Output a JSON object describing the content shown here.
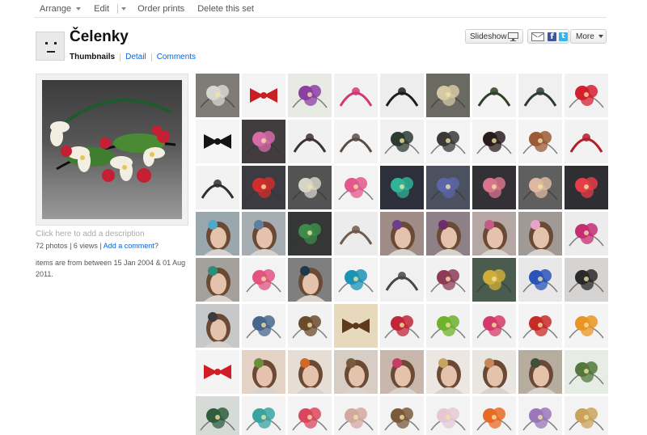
{
  "toolbar": {
    "arrange": "Arrange",
    "edit": "Edit",
    "order_prints": "Order prints",
    "delete_set": "Delete this set"
  },
  "set": {
    "title": "Čelenky",
    "tabs": {
      "thumbnails": "Thumbnails",
      "detail": "Detail",
      "comments": "Comments"
    },
    "add_description": "Click here to add a description",
    "photos": "72 photos",
    "views": "6 views",
    "add_comment": "Add a comment",
    "question": "?",
    "dates": "items are from between 15 Jan 2004 & 01 Aug 2011."
  },
  "buttons": {
    "slideshow": "Slideshow",
    "more": "More",
    "facebook": "f",
    "twitter": "t"
  },
  "thumbnails": [
    {
      "bg": "#7f7c77",
      "fg": "#d7d7d2",
      "shape": "flower",
      "subject": "fabric flower"
    },
    {
      "bg": "#f3f3f3",
      "fg": "#c81f25",
      "shape": "bow",
      "subject": "red rosette"
    },
    {
      "bg": "#e8ebe3",
      "fg": "#8b3fa2",
      "shape": "flower",
      "subject": "fabric flowers"
    },
    {
      "bg": "#f2f2f2",
      "fg": "#d23873",
      "shape": "band",
      "subject": "pink headband"
    },
    {
      "bg": "#ededed",
      "fg": "#1d1d1d",
      "shape": "band",
      "subject": "black headband"
    },
    {
      "bg": "#6b6a62",
      "fg": "#d5c8a5",
      "shape": "flower",
      "subject": "braided band"
    },
    {
      "bg": "#f4f4f4",
      "fg": "#2f4126",
      "shape": "band",
      "subject": "green headband"
    },
    {
      "bg": "#f0f0f0",
      "fg": "#2b3b33",
      "shape": "band",
      "subject": "dark headband"
    },
    {
      "bg": "#f2f2f2",
      "fg": "#d41f2f",
      "shape": "flower",
      "subject": "red flowers"
    },
    {
      "bg": "#f5f5f5",
      "fg": "#141414",
      "shape": "bow",
      "subject": "black bow"
    },
    {
      "bg": "#413d3f",
      "fg": "#d86aa9",
      "shape": "flower",
      "subject": "pink flower"
    },
    {
      "bg": "#f1f1f1",
      "fg": "#3c3032",
      "shape": "band",
      "subject": "beaded band"
    },
    {
      "bg": "#f4f4f4",
      "fg": "#5b4d46",
      "shape": "band",
      "subject": "jeweled band"
    },
    {
      "bg": "#f1f1f1",
      "fg": "#2d3b32",
      "shape": "flower",
      "subject": "crystal band"
    },
    {
      "bg": "#f3f3f3",
      "fg": "#3a3a3a",
      "shape": "flower",
      "subject": "brooch band"
    },
    {
      "bg": "#f3f3f3",
      "fg": "#2a1c1c",
      "shape": "flower",
      "subject": "black flower"
    },
    {
      "bg": "#f4f4f4",
      "fg": "#9b5a36",
      "shape": "flower",
      "subject": "beaded flower"
    },
    {
      "bg": "#f2f2f2",
      "fg": "#b21d2a",
      "shape": "band",
      "subject": "red beaded"
    },
    {
      "bg": "#f2f2f2",
      "fg": "#2f2f2f",
      "shape": "band",
      "subject": "crystal band"
    },
    {
      "bg": "#3c3b41",
      "fg": "#d12d2d",
      "shape": "flower",
      "subject": "red flower"
    },
    {
      "bg": "#535353",
      "fg": "#d6d3c7",
      "shape": "flower",
      "subject": "lace"
    },
    {
      "bg": "#f3f3f3",
      "fg": "#e3578c",
      "shape": "flower",
      "subject": "pink feathers"
    },
    {
      "bg": "#2d2f3a",
      "fg": "#2eb397",
      "shape": "flower",
      "subject": "teal roses"
    },
    {
      "bg": "#4c5160",
      "fg": "#5a66a8",
      "shape": "flower",
      "subject": "blue flowers"
    },
    {
      "bg": "#333135",
      "fg": "#d8748c",
      "shape": "flower",
      "subject": "pink lace"
    },
    {
      "bg": "#5f5f5f",
      "fg": "#ddb8a0",
      "shape": "flower",
      "subject": "cream roses"
    },
    {
      "bg": "#2e2e33",
      "fg": "#e53d49",
      "shape": "flower",
      "subject": "red roses"
    },
    {
      "bg": "#9aa7ad",
      "fg": "#52a7c7",
      "shape": "portrait",
      "subject": "portrait"
    },
    {
      "bg": "#a6aeb3",
      "fg": "#5f7fa0",
      "shape": "portrait",
      "subject": "portrait"
    },
    {
      "bg": "#353737",
      "fg": "#3d8b4b",
      "shape": "flower",
      "subject": "green bow"
    },
    {
      "bg": "#ececec",
      "fg": "#6d5b4f",
      "shape": "band",
      "subject": "brown band"
    },
    {
      "bg": "#9f8c86",
      "fg": "#6c3d8c",
      "shape": "portrait",
      "subject": "portrait"
    },
    {
      "bg": "#8d8086",
      "fg": "#6f2c6c",
      "shape": "portrait",
      "subject": "portrait"
    },
    {
      "bg": "#b4a7a4",
      "fg": "#c75a86",
      "shape": "portrait",
      "subject": "portrait"
    },
    {
      "bg": "#9f9a95",
      "fg": "#e8a4c8",
      "shape": "portrait",
      "subject": "portrait"
    },
    {
      "bg": "#ececec",
      "fg": "#c62e74",
      "shape": "flower",
      "subject": "magenta flower"
    },
    {
      "bg": "#a4a09c",
      "fg": "#2c8d7c",
      "shape": "portrait",
      "subject": "portrait"
    },
    {
      "bg": "#f3f3f3",
      "fg": "#e0547f",
      "shape": "flower",
      "subject": "pink feather"
    },
    {
      "bg": "#7f7f7f",
      "fg": "#1f3848",
      "shape": "portrait",
      "subject": "portrait"
    },
    {
      "bg": "#f3f3f3",
      "fg": "#1c93b5",
      "shape": "flower",
      "subject": "blue feathers"
    },
    {
      "bg": "#f0f0f0",
      "fg": "#474747",
      "shape": "band",
      "subject": "plain band"
    },
    {
      "bg": "#f1f1f1",
      "fg": "#8e3c56",
      "shape": "flower",
      "subject": "mixed flower"
    },
    {
      "bg": "#4a5c4d",
      "fg": "#cfad3a",
      "shape": "flower",
      "subject": "gold flower"
    },
    {
      "bg": "#e8e8e8",
      "fg": "#2954b8",
      "shape": "flower",
      "subject": "blue beads"
    },
    {
      "bg": "#d6d4d2",
      "fg": "#2a2a2a",
      "shape": "flower",
      "subject": "black band"
    },
    {
      "bg": "#c6c8c9",
      "fg": "#3c3c3c",
      "shape": "portrait",
      "subject": "portrait"
    },
    {
      "bg": "#f3f3f3",
      "fg": "#46668c",
      "shape": "flower",
      "subject": "blue flower"
    },
    {
      "bg": "#f2f2f2",
      "fg": "#6b4b2e",
      "shape": "flower",
      "subject": "brown flower"
    },
    {
      "bg": "#e6d9bc",
      "fg": "#5e3a1c",
      "shape": "bow",
      "subject": "brown feathers"
    },
    {
      "bg": "#f2f2f2",
      "fg": "#c02638",
      "shape": "flower",
      "subject": "red flowers"
    },
    {
      "bg": "#f2f2f2",
      "fg": "#6fb22e",
      "shape": "flower",
      "subject": "green leaf"
    },
    {
      "bg": "#f2f2f2",
      "fg": "#d4396a",
      "shape": "flower",
      "subject": "fan"
    },
    {
      "bg": "#f4f4f4",
      "fg": "#c72b27",
      "shape": "flower",
      "subject": "red flowers"
    },
    {
      "bg": "#f4f4f4",
      "fg": "#e99523",
      "shape": "flower",
      "subject": "orange flower"
    },
    {
      "bg": "#f4f4f4",
      "fg": "#d11d25",
      "shape": "bow",
      "subject": "red bow"
    },
    {
      "bg": "#e5d4c6",
      "fg": "#6b8f3a",
      "shape": "portrait",
      "subject": "portrait"
    },
    {
      "bg": "#e6ddd5",
      "fg": "#cf6a25",
      "shape": "portrait",
      "subject": "portrait"
    },
    {
      "bg": "#d8cdc5",
      "fg": "#7a5a3c",
      "shape": "portrait",
      "subject": "portrait"
    },
    {
      "bg": "#c9b7ad",
      "fg": "#c73c66",
      "shape": "portrait",
      "subject": "portrait"
    },
    {
      "bg": "#ece7e2",
      "fg": "#c6a45f",
      "shape": "portrait",
      "subject": "portrait"
    },
    {
      "bg": "#e9e5e1",
      "fg": "#c8855a",
      "shape": "portrait",
      "subject": "portrait"
    },
    {
      "bg": "#b7ad9f",
      "fg": "#3f4f3a",
      "shape": "portrait",
      "subject": "feather portrait"
    },
    {
      "bg": "#e7ece5",
      "fg": "#52783b",
      "shape": "flower",
      "subject": "green feathers"
    },
    {
      "bg": "#d6dbd8",
      "fg": "#2f5d3d",
      "shape": "flower",
      "subject": "green feathers"
    },
    {
      "bg": "#f3f3f3",
      "fg": "#3aa3a0",
      "shape": "flower",
      "subject": "teal roses"
    },
    {
      "bg": "#f3f3f3",
      "fg": "#d9465d",
      "shape": "flower",
      "subject": "pink roses"
    },
    {
      "bg": "#f3f3f3",
      "fg": "#d2a8a0",
      "shape": "flower",
      "subject": "cream roses"
    },
    {
      "bg": "#f3f3f3",
      "fg": "#7b5a3c",
      "shape": "flower",
      "subject": "brown roses"
    },
    {
      "bg": "#f3f3f3",
      "fg": "#e6c8d4",
      "shape": "flower",
      "subject": "white flowers"
    },
    {
      "bg": "#f3f3f3",
      "fg": "#e86a26",
      "shape": "flower",
      "subject": "orange roses"
    },
    {
      "bg": "#f3f3f3",
      "fg": "#9a77b8",
      "shape": "flower",
      "subject": "lilac flowers"
    },
    {
      "bg": "#f3f3f3",
      "fg": "#c9a35a",
      "shape": "flower",
      "subject": "gold roses"
    }
  ]
}
